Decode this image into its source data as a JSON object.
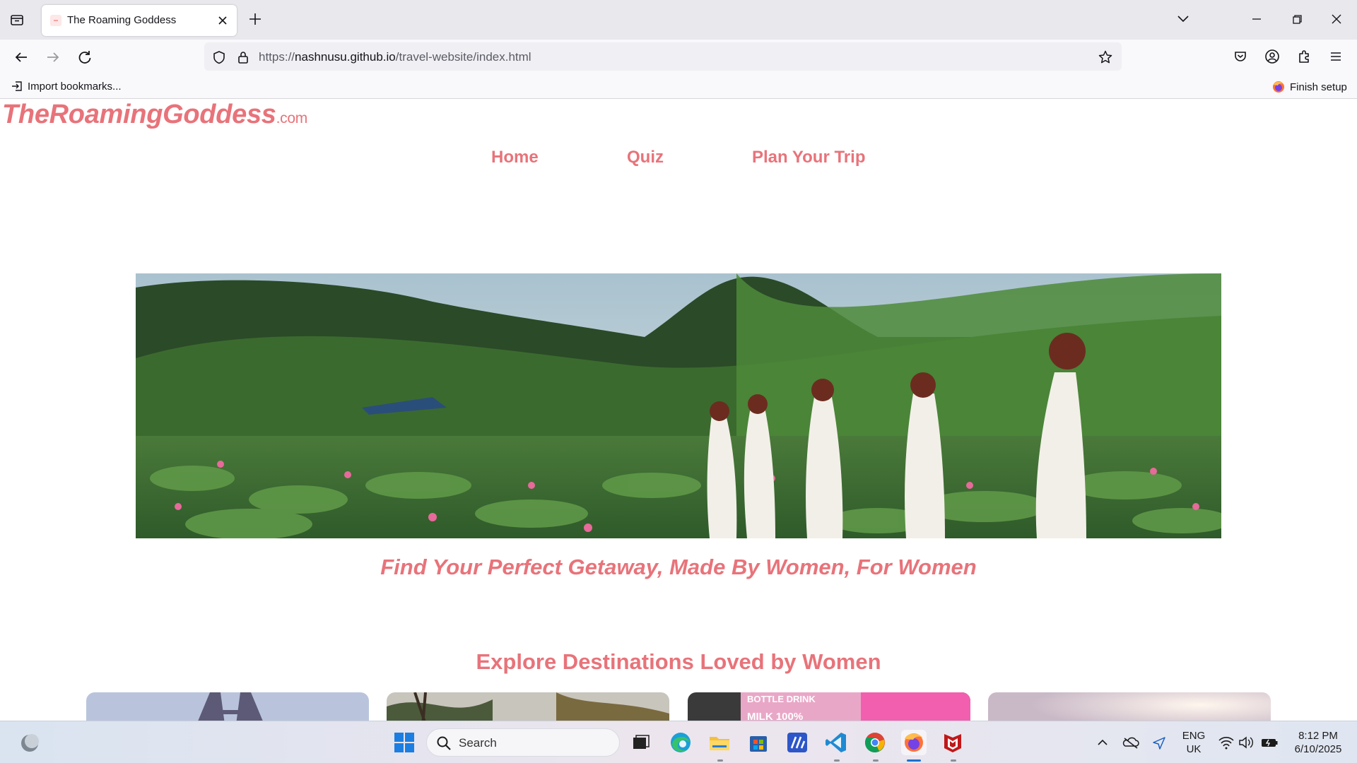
{
  "browser": {
    "tab_title": "The Roaming Goddess",
    "url_prefix": "https://",
    "url_domain": "nashnusu.github.io",
    "url_path": "/travel-website/index.html",
    "bookmark_import": "Import bookmarks...",
    "finish_setup": "Finish setup"
  },
  "site": {
    "logo_main": "TheRoamingGoddess",
    "logo_suffix": ".com",
    "nav": [
      "Home",
      "Quiz",
      "Plan Your Trip"
    ],
    "tagline": "Find Your Perfect Getaway, Made By Women, For Women",
    "section_title": "Explore Destinations Loved by Women",
    "card_top_text": [
      "BOTTLE DRINK",
      "MILK 100%"
    ]
  },
  "taskbar": {
    "search_placeholder": "Search",
    "lang_line1": "ENG",
    "lang_line2": "UK",
    "time": "8:12 PM",
    "date": "6/10/2025"
  },
  "colors": {
    "brand_pink": "#e8737a",
    "chrome_bg": "#e8e8ed",
    "toolbar_bg": "#f9f9fb"
  }
}
